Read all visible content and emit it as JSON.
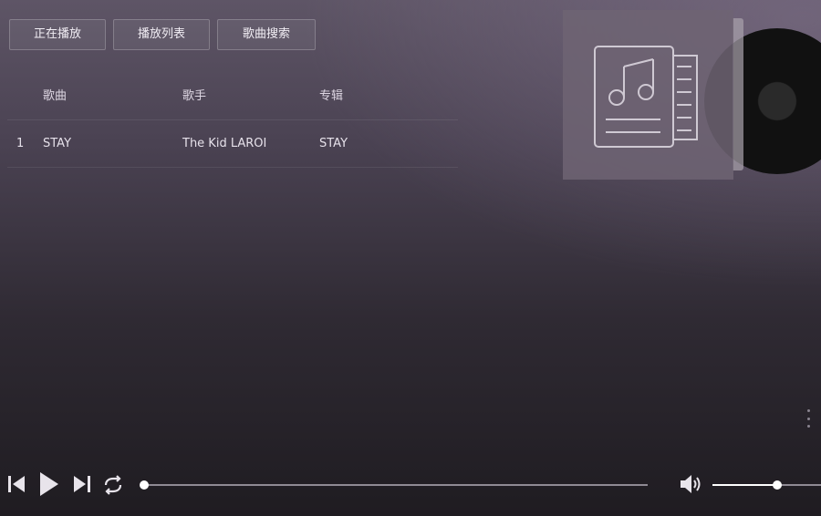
{
  "tabs": [
    {
      "label": "正在播放"
    },
    {
      "label": "播放列表"
    },
    {
      "label": "歌曲搜索"
    }
  ],
  "playlist": {
    "headers": {
      "song": "歌曲",
      "artist": "歌手",
      "album": "专辑"
    },
    "rows": [
      {
        "num": "1",
        "song": "STAY",
        "artist": "The Kid LAROI",
        "album": "STAY"
      }
    ]
  },
  "album_art": {
    "icon": "music-note-document-icon"
  },
  "player": {
    "progress": 0.0,
    "volume": 0.6,
    "icons": {
      "prev": "skip-previous-icon",
      "play": "play-icon",
      "next": "skip-next-icon",
      "repeat": "repeat-icon",
      "volume": "volume-icon"
    }
  },
  "colors": {
    "accent": "#ffffff",
    "track": "#8f8a94"
  }
}
